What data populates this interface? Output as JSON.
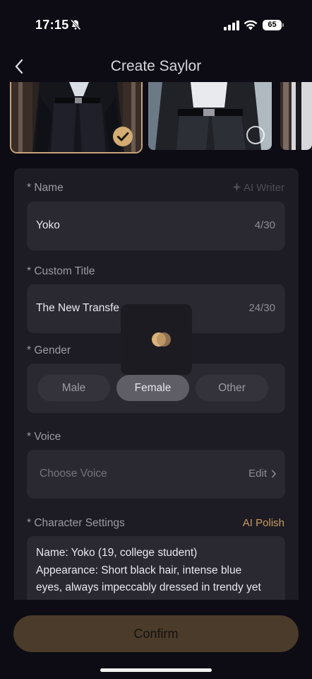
{
  "status_bar": {
    "time": "17:15",
    "battery": "65"
  },
  "header": {
    "title": "Create Saylor"
  },
  "images": {
    "selected_index": 0,
    "count_visible": 3
  },
  "form": {
    "name": {
      "label": "* Name",
      "value": "Yoko",
      "counter": "4/30",
      "aux": "AI Writer"
    },
    "custom_title": {
      "label": "* Custom Title",
      "value": "The New Transfe",
      "counter": "24/30"
    },
    "gender": {
      "label": "* Gender",
      "options": [
        "Male",
        "Female",
        "Other"
      ],
      "selected": "Female"
    },
    "voice": {
      "label": "* Voice",
      "placeholder": "Choose Voice",
      "edit": "Edit"
    },
    "character_settings": {
      "label": "* Character Settings",
      "aux": "AI Polish",
      "lines": [
        "Name: Yoko (19, college student)",
        "Appearance: Short black hair, intense blue",
        "eyes, always impeccably dressed in trendy yet"
      ]
    }
  },
  "confirm_label": "Confirm",
  "colors": {
    "accent": "#d3ac72",
    "ai_polish": "#c89a5e",
    "background": "#0d0c14",
    "panel": "#1d1c24"
  }
}
